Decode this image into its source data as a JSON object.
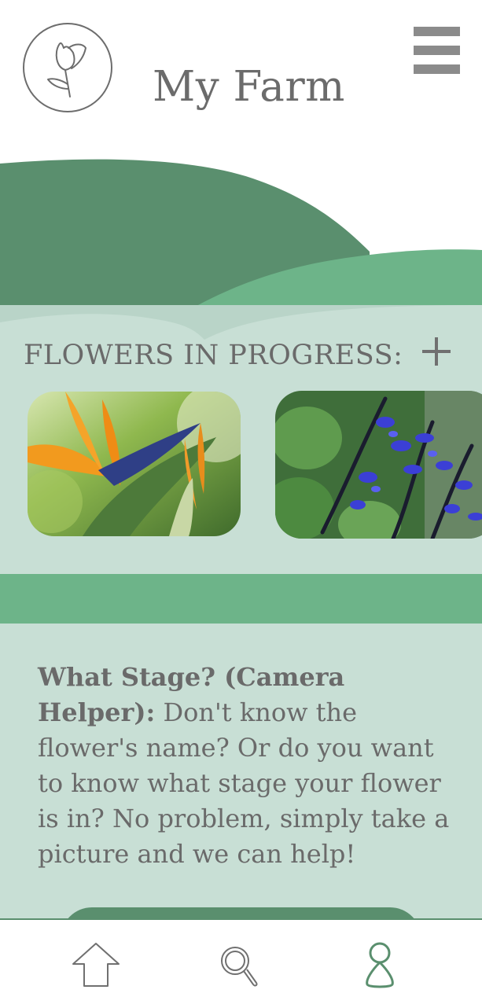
{
  "header": {
    "title": "My Farm",
    "logo_icon": "tulip-icon",
    "menu_icon": "hamburger-menu-icon"
  },
  "flowers": {
    "title": "FLOWERS IN PROGRESS:",
    "add_icon": "plus-icon",
    "items": [
      {
        "image": "bird-of-paradise-photo"
      },
      {
        "image": "purple-salvia-photo"
      }
    ]
  },
  "helper": {
    "heading": "What Stage? (Camera Helper):",
    "body": "Don't know the flower's name? Or do you want to know what stage your flower is in? No problem, simply take a picture and we can help!"
  },
  "nav": {
    "items": [
      {
        "icon": "home-icon"
      },
      {
        "icon": "search-icon"
      },
      {
        "icon": "profile-icon"
      }
    ]
  },
  "colors": {
    "dark_green": "#5a8f6e",
    "mid_green": "#6db489",
    "light_green": "#c8dfd5",
    "text_gray": "#6a6a6a"
  }
}
